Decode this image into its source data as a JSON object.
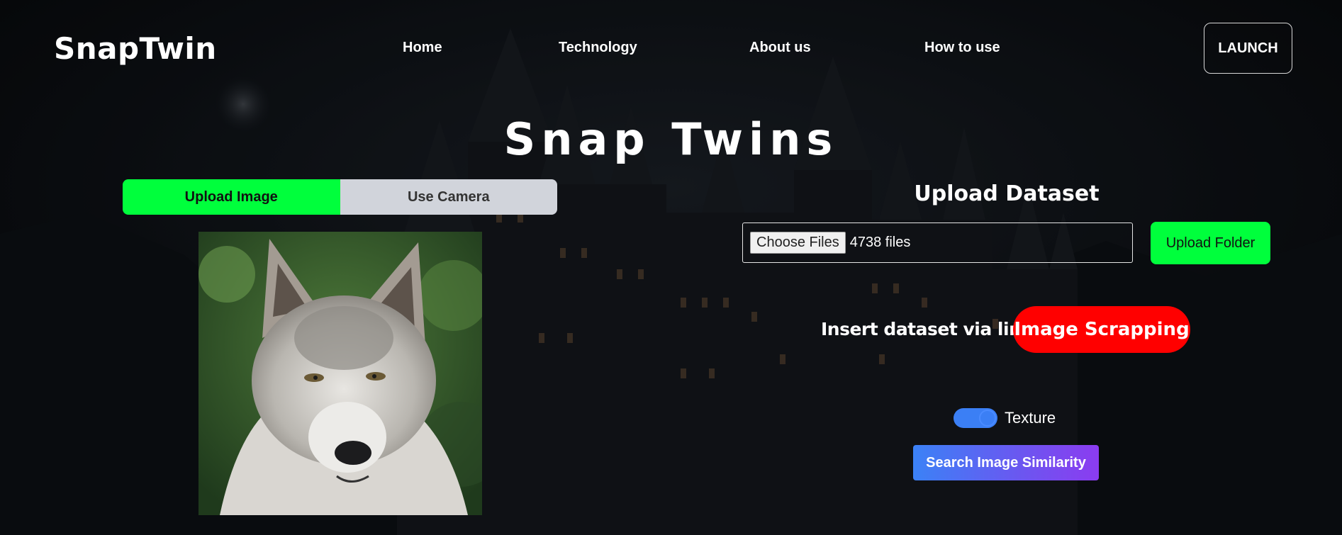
{
  "brand": {
    "logo": "SnapTwin"
  },
  "nav": {
    "items": [
      {
        "label": "Home"
      },
      {
        "label": "Technology"
      },
      {
        "label": "About us"
      },
      {
        "label": "How to use"
      }
    ],
    "launch_label": "LAUNCH"
  },
  "hero": {
    "title": "Snap Twins"
  },
  "input_tabs": {
    "upload_label": "Upload Image",
    "camera_label": "Use Camera",
    "active": "Upload Image"
  },
  "dataset": {
    "title": "Upload Dataset",
    "choose_files_label": "Choose Files",
    "file_count": "4738 files",
    "upload_folder_label": "Upload Folder",
    "insert_link_label": "Insert dataset via link:",
    "scrapping_label": "Image Scrapping"
  },
  "options": {
    "texture_label": "Texture",
    "texture_enabled": true
  },
  "actions": {
    "search_label": "Search Image Similarity"
  },
  "colors": {
    "accent_green": "#00ff3c",
    "accent_red": "#ff0000",
    "toggle_blue": "#3b7ff5",
    "gradient_start": "#3b82f6",
    "gradient_end": "#8b3cf0"
  }
}
